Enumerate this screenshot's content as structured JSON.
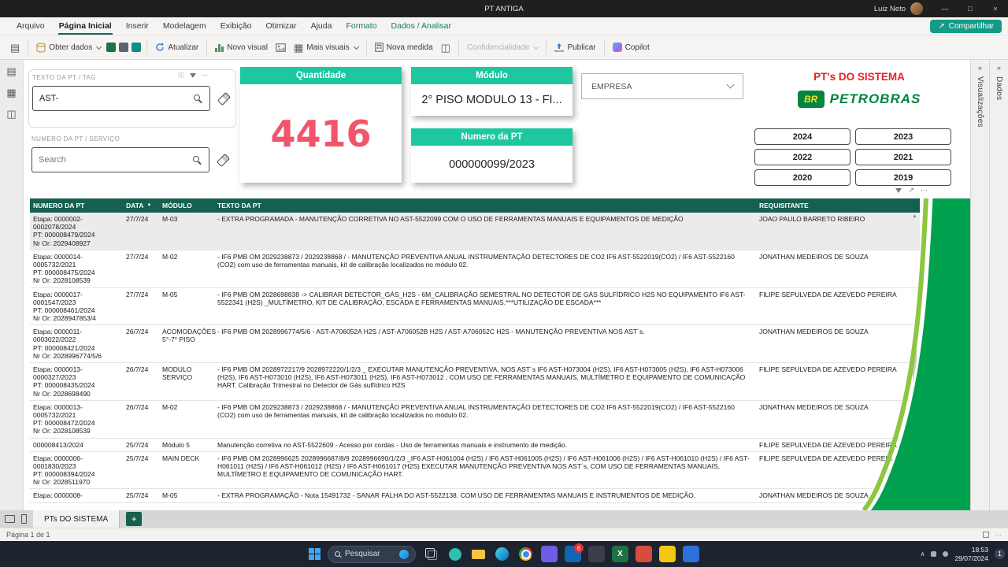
{
  "titlebar": {
    "title": "PT ANTIGA",
    "user": "Luiz Neto"
  },
  "menubar": {
    "items": [
      {
        "label": "Arquivo",
        "active": false,
        "contextual": false
      },
      {
        "label": "Página Inicial",
        "active": true,
        "contextual": false
      },
      {
        "label": "Inserir",
        "active": false,
        "contextual": false
      },
      {
        "label": "Modelagem",
        "active": false,
        "contextual": false
      },
      {
        "label": "Exibição",
        "active": false,
        "contextual": false
      },
      {
        "label": "Otimizar",
        "active": false,
        "contextual": false
      },
      {
        "label": "Ajuda",
        "active": false,
        "contextual": false
      },
      {
        "label": "Formato",
        "active": false,
        "contextual": true
      },
      {
        "label": "Dados / Analisar",
        "active": false,
        "contextual": true
      }
    ],
    "share_label": "Compartilhar"
  },
  "ribbon": {
    "obter_dados": "Obter dados",
    "atualizar": "Atualizar",
    "novo_visual": "Novo visual",
    "mais_visuais": "Mais visuais",
    "nova_medida": "Nova medida",
    "confidencialidade": "Confidencialidade",
    "publicar": "Publicar",
    "copilot": "Copilot"
  },
  "slicers": {
    "texto": {
      "title": "TEXTO DA PT / TAG",
      "value": "AST-"
    },
    "numero": {
      "title": "NUMERO DA PT / SERVIÇO",
      "placeholder": "Search"
    }
  },
  "cards": {
    "quantidade": {
      "title": "Quantidade",
      "value": "4416"
    },
    "modulo": {
      "title": "Módulo",
      "value": "2° PISO MODULO 13 - FI..."
    },
    "numero_pt": {
      "title": "Numero da PT",
      "value": "000000099/2023"
    }
  },
  "empresa_dropdown": {
    "label": "EMPRESA"
  },
  "branding": {
    "title": "PT's DO SISTEMA",
    "logo_br": "BR",
    "logo_text": "PETROBRAS"
  },
  "years": [
    "2024",
    "2023",
    "2022",
    "2021",
    "2020",
    "2019"
  ],
  "table": {
    "headers": [
      "NUMERO DA PT",
      "DATA",
      "MÓDULO",
      "TEXTO DA PT",
      "REQUISITANTE"
    ],
    "rows": [
      {
        "numero": "Etapa: 0000002-\n0002078/2024\nPT: 000008479/2024\nNr Or: 2029408927",
        "data": "27/7/24",
        "modulo": "M-03",
        "texto": "- EXTRA PROGRAMADA - MANUTENÇÃO CORRETIVA NO AST-5522099 COM O USO DE FERRAMENTAS MANUAIS E EQUIPAMENTOS DE MEDIÇÃO",
        "requisitante": "JOAO PAULO BARRETO RIBEIRO"
      },
      {
        "numero": "Etapa: 0000014-\n0005732/2021\nPT: 000008475/2024\nNr Or: 2028108539",
        "data": "27/7/24",
        "modulo": "M-02",
        "texto": "- IF6 PMB OM 2029238873 / 2029238868 / - MANUTENÇÃO PREVENTIVA ANUAL INSTRUMENTAÇÃO DETECTORES DE CO2 IF6 AST-5522019(CO2) / IF6 AST-5522160 (CO2) com uso de ferramentas manuais, kit de calibração localizados no módulo 02.",
        "requisitante": "JONATHAN MEDEIROS DE SOUZA"
      },
      {
        "numero": "Etapa: 0000017-\n0001547/2023\nPT: 000008461/2024\nNr Or: 2028947853/4",
        "data": "27/7/24",
        "modulo": "M-05",
        "texto": "- IF6 PMB OM 2028698838 -> CALIBRAR DETECTOR_GÁS_H2S - 6M_CALIBRAÇÃO SEMESTRAL NO DETECTOR DE GÁS SULFÍDRICO H2S NO EQUIPAMENTO IF6 AST-5522341 (H2S) _MULTÍMETRO, KIT DE CALIBRAÇÃO, ESCADA E FERRAMENTAS MANUAIS.***UTILIZAÇÃO DE ESCADA***",
        "requisitante": "FILIPE SEPULVEDA DE AZEVEDO PEREIRA"
      },
      {
        "numero": "Etapa: 0000011-\n0003022/2022\nPT: 000008421/2024\nNr Or: 2028996774/5/6",
        "data": "26/7/24",
        "modulo": "ACOMODAÇÕES 5°-7° PISO",
        "texto": "- IF6 PMB OM 2028996774/5/6 - AST-A706052A H2S / AST-A706052B H2S / AST-A706052C H2S - MANUTENÇÃO PREVENTIVA NOS AST´s.",
        "requisitante": "JONATHAN MEDEIROS DE SOUZA"
      },
      {
        "numero": "Etapa: 0000013-\n0000327/2023\nPT: 000008435/2024\nNr Or: 2028698490",
        "data": "26/7/24",
        "modulo": "MODULO SERVIÇO",
        "texto": "- IF6 PMB OM 2028972217/9 2028972220/1/2/3 _ EXECUTAR MANUTENÇÃO PREVENTIVA, NOS AST´s IF6 AST-H073004 (H2S), IF6 AST-H073005 (H2S), IF6 AST-H073006 (H2S), IF6 AST-H073010 (H2S), IF6 AST-H073011 (H2S), IF6 AST-H073012 , COM USO DE FERRAMENTAS MANUAIS, MULTÍMETRO E EQUIPAMENTO DE COMUNICAÇÃO HART. Calibração Trimestral no Detector de Gás sulfídrico H2S",
        "requisitante": "FILIPE SEPULVEDA DE AZEVEDO PEREIRA"
      },
      {
        "numero": "Etapa: 0000013-\n0005732/2021\nPT: 000008472/2024\nNr Or: 2028108539",
        "data": "26/7/24",
        "modulo": "M-02",
        "texto": "- IF6 PMB OM 2029238873 / 2029238868 / - MANUTENÇÃO PREVENTIVA ANUAL INSTRUMENTAÇÃO DETECTORES DE CO2 IF6 AST-5522019(CO2) / IF6 AST-5522160 (CO2) com uso de ferramentas manuais, kit de calibração localizados no módulo 02.",
        "requisitante": "JONATHAN MEDEIROS DE SOUZA"
      },
      {
        "numero": "000008413/2024",
        "data": "25/7/24",
        "modulo": "Módulo 5",
        "texto": "Manutenção corretiva no AST-5522609 - Acesso por cordas - Uso de ferramentas manuais e instrumento de medição.",
        "requisitante": "FILIPE SEPULVEDA DE AZEVEDO PEREIRA"
      },
      {
        "numero": "Etapa: 0000006-\n0001830/2023\nPT: 000008394/2024\nNr Or: 2028511970",
        "data": "25/7/24",
        "modulo": "MAIN DECK",
        "texto": "- IF6 PMB OM 2028996625 2028996687/8/9 2028996690/1/2/3 _IF6 AST-H061004 (H2S) / IF6 AST-H061005 (H2S) / IF6 AST-H061006 (H2S) / IF6 AST-H061010 (H2S) / IF6 AST-H061011 (H2S) / IF6 AST-H061012 (H2S) / IF6 AST-H061017 (H2S) EXECUTAR MANUTENÇÃO PREVENTIVA NOS AST´s, COM USO DE FERRAMENTAS MANUAIS, MULTÍMETRO E EQUIPAMENTO DE COMUNICAÇÃO HART.",
        "requisitante": "FILIPE SEPULVEDA DE AZEVEDO PEREIRA"
      },
      {
        "numero": "Etapa: 0000008-",
        "data": "25/7/24",
        "modulo": "M-05",
        "texto": "- EXTRA PROGRAMAÇÃO - Nota 15491732 - SANAR FALHA DO AST-5522138. COM USO DE FERRAMENTAS MANUAIS E INSTRUMENTOS DE MEDIÇÃO.",
        "requisitante": "JONATHAN MEDEIROS DE SOUZA"
      }
    ]
  },
  "right_rail": {
    "panels": [
      "Visualizações",
      "Dados"
    ]
  },
  "footer": {
    "tab": "PTs DO SISTEMA",
    "page_status": "Página 1 de 1"
  },
  "taskbar": {
    "search_placeholder": "Pesquisar",
    "time": "18:53",
    "date": "29/07/2024",
    "notif": "1",
    "app_icons": [
      {
        "name": "task-view-icon",
        "kind": "taskview"
      },
      {
        "name": "chat-icon",
        "kind": "dot",
        "color": "#2fbfae"
      },
      {
        "name": "file-explorer-icon",
        "kind": "folder",
        "color": "#f6c344"
      },
      {
        "name": "edge-icon",
        "kind": "ring"
      },
      {
        "name": "chrome-icon",
        "kind": "chrome"
      },
      {
        "name": "app-purple-icon",
        "kind": "tile",
        "color": "#6c5ce7"
      },
      {
        "name": "mail-icon",
        "kind": "tile",
        "color": "#1066b5",
        "badge": "6"
      },
      {
        "name": "app-dark-icon",
        "kind": "tile",
        "color": "#3a3f4a"
      },
      {
        "name": "excel-icon",
        "kind": "tile",
        "color": "#1e7145",
        "label": "X"
      },
      {
        "name": "app-red-icon",
        "kind": "tile",
        "color": "#d84b3e"
      },
      {
        "name": "powerbi-icon",
        "kind": "tile",
        "color": "#f2c811"
      },
      {
        "name": "app-blue-icon",
        "kind": "tile",
        "color": "#2f6fdb"
      }
    ]
  }
}
